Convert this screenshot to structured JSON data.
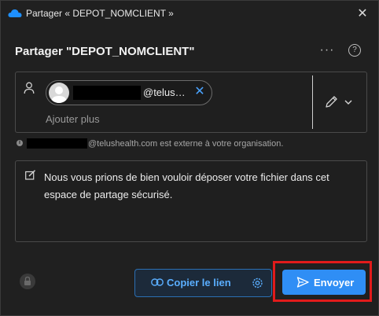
{
  "window": {
    "title": "Partager « DEPOT_NOMCLIENT »",
    "close_glyph": "✕",
    "app_icon": "onedrive-cloud-icon"
  },
  "header": {
    "title": "Partager \"DEPOT_NOMCLIENT\"",
    "more_glyph": "···",
    "help_glyph": "?"
  },
  "recipients": {
    "chip_email": "@telus…",
    "chip_remove_glyph": "✕",
    "add_placeholder": "Ajouter plus"
  },
  "notice": {
    "text": "@telushealth.com est externe à votre organisation.",
    "info_glyph": "i"
  },
  "message": {
    "text": "Nous vous prions de bien vouloir déposer votre fichier dans cet espace de partage sécurisé."
  },
  "footer": {
    "copy_link_label": "Copier le lien",
    "send_label": "Envoyer"
  },
  "colors": {
    "accent": "#2f8ef5",
    "link": "#5aaeff",
    "highlight": "#e11b1b",
    "background": "#202020"
  }
}
